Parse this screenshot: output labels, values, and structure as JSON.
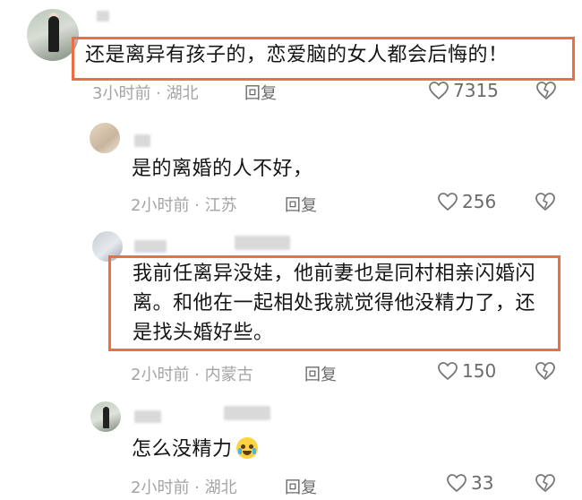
{
  "comments": [
    {
      "text": "还是离异有孩子的，恋爱脑的女人都会后悔的！",
      "meta": "3小时前 · 湖北",
      "reply": "回复",
      "likes": "7315",
      "highlighted": true
    },
    {
      "text": "是的离婚的人不好，",
      "meta": "2小时前 · 江苏",
      "reply": "回复",
      "likes": "256"
    },
    {
      "text": "我前任离异没娃，他前妻也是同村相亲闪婚闪离。和他在一起相处我就觉得他没精力了，还是找头婚好些。",
      "meta": "2小时前 · 内蒙古",
      "reply": "回复",
      "likes": "150",
      "highlighted": true
    },
    {
      "text": "怎么没精力",
      "emoji": "crying-laughing-emoji",
      "meta": "2小时前 · 湖北",
      "reply": "回复",
      "likes": "33"
    }
  ],
  "colors": {
    "highlight_border": "#ee6e41",
    "meta_text": "#a4a4a4",
    "action_text": "#6b6b6b"
  },
  "icons": [
    "heart-outline-icon",
    "broken-heart-icon"
  ]
}
